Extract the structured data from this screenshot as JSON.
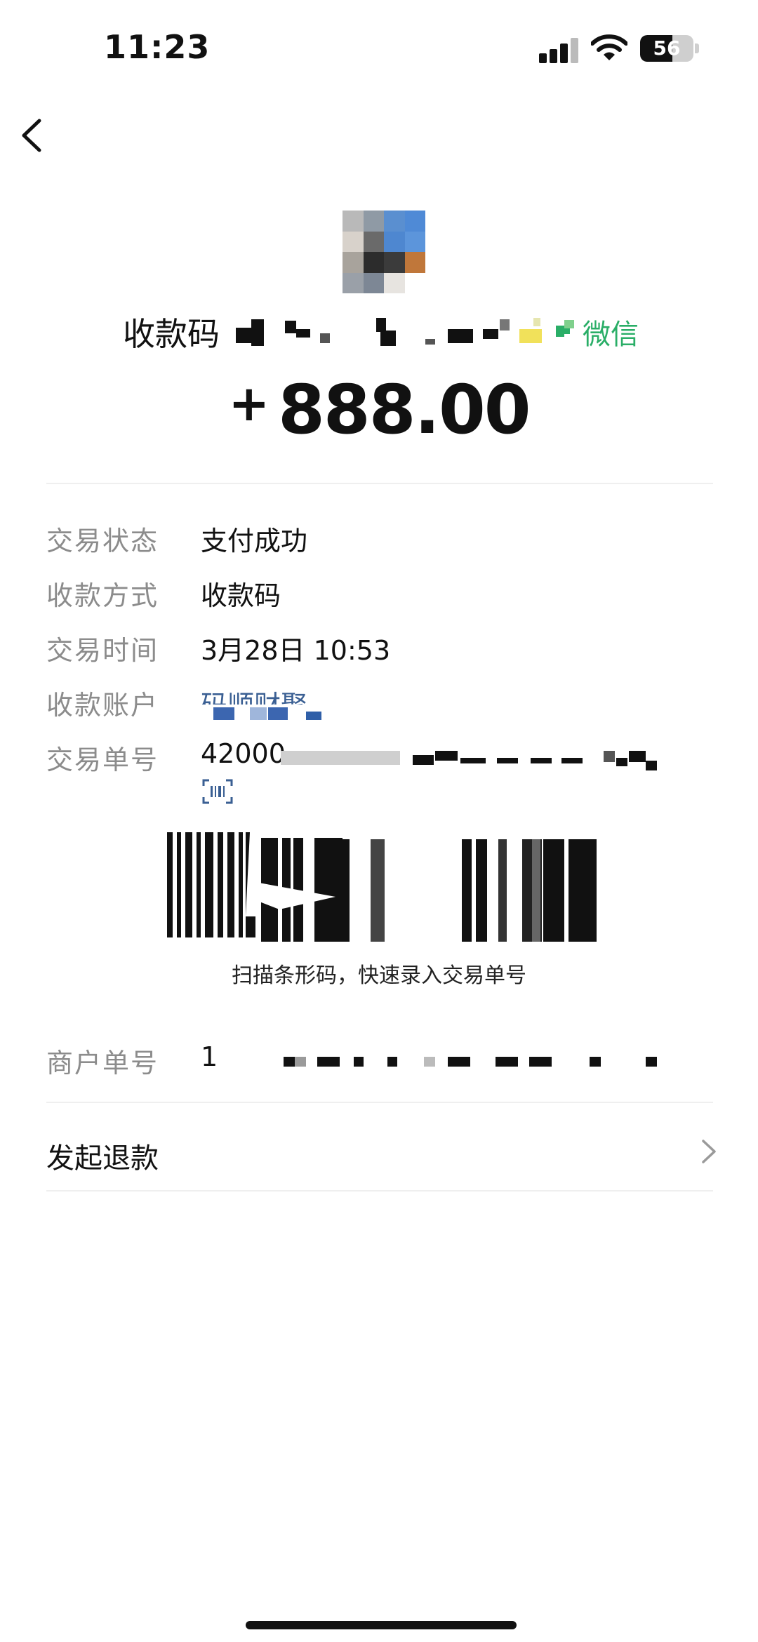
{
  "status_bar": {
    "time": "11:23",
    "battery": "56",
    "icons": [
      "signal-icon",
      "wifi-icon",
      "battery-icon"
    ]
  },
  "nav": {
    "back_icon": "chevron-left-icon"
  },
  "header": {
    "payer_label": "收款码",
    "channel": "微信",
    "amount_sign": "+",
    "amount": "888.00"
  },
  "details": [
    {
      "label": "交易状态",
      "value": "支付成功"
    },
    {
      "label": "收款方式",
      "value": "收款码"
    },
    {
      "label": "交易时间",
      "value": "3月28日 10:53"
    },
    {
      "label": "收款账户",
      "value": "码顺财聚"
    },
    {
      "label": "交易单号",
      "value": "42000"
    }
  ],
  "barcode": {
    "caption": "扫描条形码，快速录入交易单号"
  },
  "merchant": {
    "label": "商户单号",
    "value": "1"
  },
  "refund": {
    "label": "发起退款"
  },
  "colors": {
    "accent_green": "#2aae67",
    "link_blue": "#3a5f93",
    "label_gray": "#8c8c8c"
  }
}
